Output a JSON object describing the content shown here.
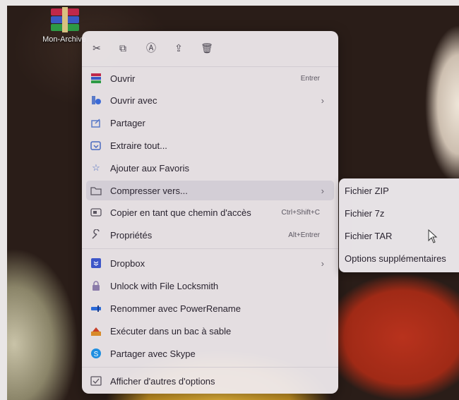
{
  "desktop": {
    "icon_label": "Mon-Archive"
  },
  "menu": {
    "toolbar": [
      {
        "name": "cut-icon",
        "glyph": "✂"
      },
      {
        "name": "copy-icon",
        "glyph": "⧉"
      },
      {
        "name": "rename-icon",
        "glyph": "Ⓐ"
      },
      {
        "name": "share-icon",
        "glyph": "⇪"
      },
      {
        "name": "delete-icon",
        "glyph": "🗑"
      }
    ],
    "items": [
      {
        "label": "Ouvrir",
        "shortcut": "Entrer",
        "icon": "archive-icon"
      },
      {
        "label": "Ouvrir avec",
        "arrow": "›",
        "icon": "open-with-icon"
      },
      {
        "label": "Partager",
        "icon": "share-icon"
      },
      {
        "label": "Extraire tout...",
        "icon": "extract-icon"
      },
      {
        "label": "Ajouter aux Favoris",
        "icon": "star-icon"
      },
      {
        "label": "Compresser vers...",
        "arrow": "›",
        "icon": "folder-icon"
      },
      {
        "label": "Copier en tant que chemin d'accès",
        "shortcut": "Ctrl+Shift+C",
        "icon": "copy-path-icon"
      },
      {
        "label": "Propriétés",
        "shortcut": "Alt+Entrer",
        "icon": "wrench-icon"
      },
      {
        "label": "Dropbox",
        "arrow": "›",
        "icon": "dropbox-icon"
      },
      {
        "label": "Unlock with File Locksmith",
        "icon": "lock-icon"
      },
      {
        "label": "Renommer avec PowerRename",
        "icon": "rename-icon"
      },
      {
        "label": "Exécuter dans un bac à sable",
        "icon": "sandbox-icon"
      },
      {
        "label": "Partager avec Skype",
        "icon": "skype-icon"
      },
      {
        "label": "Afficher d'autres d'options",
        "icon": "more-options-icon"
      }
    ]
  },
  "submenu": {
    "items": [
      "Fichier ZIP",
      "Fichier 7z",
      "Fichier TAR",
      "Options supplémentaires"
    ]
  }
}
